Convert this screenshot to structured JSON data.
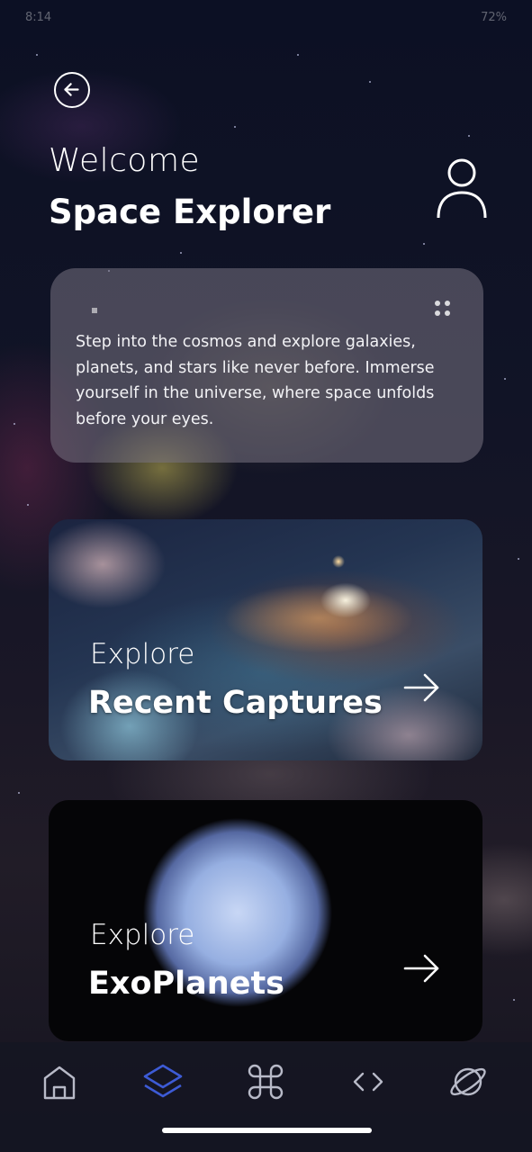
{
  "status_bar": {
    "time": "8:14",
    "battery": "72%"
  },
  "header": {
    "greeting": "Welcome",
    "username": "Space Explorer"
  },
  "intro": {
    "text": "Step into the cosmos and explore galaxies, planets, and stars like never before. Immerse yourself in the universe, where space unfolds before your eyes."
  },
  "cards": [
    {
      "label": "Explore",
      "title": "Recent Captures"
    },
    {
      "label": "Explore",
      "title": "ExoPlanets"
    }
  ],
  "nav": {
    "items": [
      {
        "icon": "home-icon",
        "active": false
      },
      {
        "icon": "layers-icon",
        "active": true
      },
      {
        "icon": "command-icon",
        "active": false
      },
      {
        "icon": "code-icon",
        "active": false
      },
      {
        "icon": "planet-icon",
        "active": false
      }
    ],
    "active_color": "#3d5bd6",
    "inactive_color": "#b8bac8"
  }
}
